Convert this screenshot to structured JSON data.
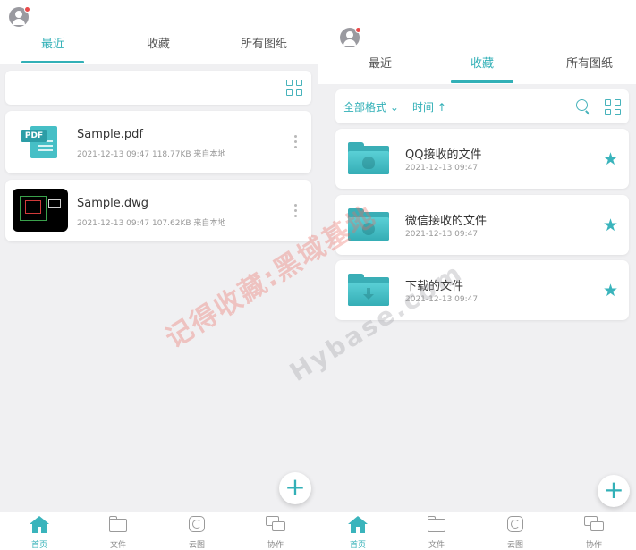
{
  "left_screen": {
    "tabs": [
      {
        "label": "最近",
        "active": true
      },
      {
        "label": "收藏",
        "active": false
      },
      {
        "label": "所有图纸",
        "active": false
      }
    ],
    "files": [
      {
        "thumb": "pdf",
        "thumb_tag": "PDF",
        "name": "Sample.pdf",
        "meta": "2021-12-13 09:47  118.77KB  来自本地"
      },
      {
        "thumb": "dwg",
        "name": "Sample.dwg",
        "meta": "2021-12-13 09:47  107.62KB  来自本地"
      }
    ],
    "fab_icon": "+",
    "nav": [
      {
        "label": "首页",
        "icon": "home-icon",
        "active": true
      },
      {
        "label": "文件",
        "icon": "folder-icon",
        "active": false
      },
      {
        "label": "云图",
        "icon": "cloud-drawing-icon",
        "active": false
      },
      {
        "label": "协作",
        "icon": "collaboration-icon",
        "active": false
      }
    ]
  },
  "right_screen": {
    "tabs": [
      {
        "label": "最近",
        "active": false
      },
      {
        "label": "收藏",
        "active": true
      },
      {
        "label": "所有图纸",
        "active": false
      }
    ],
    "toolbar": {
      "format_filter": "全部格式 ⌄",
      "sort_filter": "时间 ↑"
    },
    "folders": [
      {
        "name": "QQ接收的文件",
        "date": "2021-12-13 09:47",
        "icon": "qq-folder-icon",
        "starred": true
      },
      {
        "name": "微信接收的文件",
        "date": "2021-12-13 09:47",
        "icon": "wechat-folder-icon",
        "starred": true
      },
      {
        "name": "下载的文件",
        "date": "2021-12-13 09:47",
        "icon": "download-folder-icon",
        "starred": true
      }
    ],
    "star_glyph": "★",
    "fab_icon": "+",
    "nav": [
      {
        "label": "首页",
        "icon": "home-icon",
        "active": true
      },
      {
        "label": "文件",
        "icon": "folder-icon",
        "active": false
      },
      {
        "label": "云图",
        "icon": "cloud-drawing-icon",
        "active": false
      },
      {
        "label": "协作",
        "icon": "collaboration-icon",
        "active": false
      }
    ]
  },
  "watermarks": [
    "记得收藏:黑域基地",
    "Hybase.com"
  ],
  "colors": {
    "accent": "#32b0b7",
    "background": "#f0f0f2",
    "badge": "#e94a4a"
  }
}
